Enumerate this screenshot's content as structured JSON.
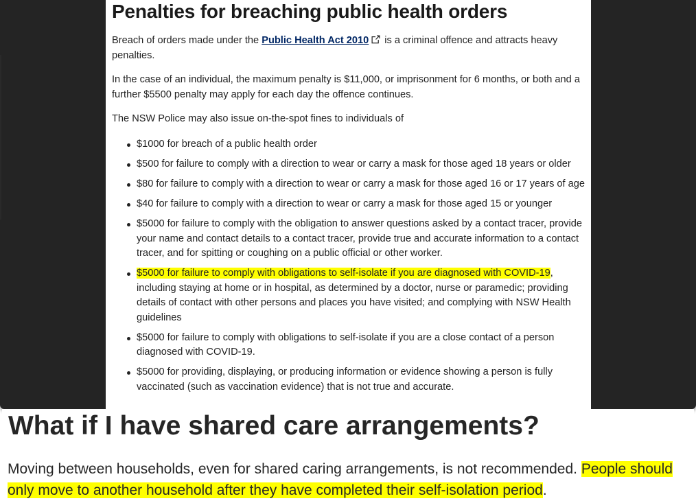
{
  "orders_section": {
    "heading": "Penalties for breaching public health orders",
    "para1_before": "Breach of orders made under the ",
    "para1_link": "Public Health Act 2010",
    "para1_link_icon": "external-link-icon",
    "para1_after": " is a criminal offence and attracts heavy penalties.",
    "para2": "In the case of an individual, the maximum penalty is $11,000, or imprisonment for 6 months, or both and a further $5500 penalty may apply for each day the offence continues.",
    "para3": "The NSW Police may also issue on-the-spot fines to individuals of",
    "fines": [
      {
        "text": "$1000 for breach of a public health order"
      },
      {
        "text": "$500 for failure to comply with a direction to wear or carry a mask for those aged 18 years or older"
      },
      {
        "text": "$80 for failure to comply with a direction to wear or carry a mask for those aged 16 or 17 years of age"
      },
      {
        "text": "$40 for failure to comply with a direction to wear or carry a mask for those aged 15 or younger"
      },
      {
        "text": "$5000 for failure to comply with the obligation to answer questions asked by a contact tracer, provide your name and contact details to a contact tracer, provide true and accurate information to a contact tracer, and for spitting or coughing on a public official or other worker."
      },
      {
        "highlight": "$5000 for failure to comply with obligations to self-isolate if you are diagnosed with COVID-19",
        "text": ", including staying at home or in hospital, as determined by a doctor, nurse or paramedic;  providing details of contact with other persons and places you have visited; and complying with NSW Health guidelines"
      },
      {
        "text": "$5000 for failure to comply with obligations to self-isolate if you are a close contact of a person diagnosed with COVID-19."
      },
      {
        "text": "$5000 for providing, displaying, or producing information or evidence showing a person is fully vaccinated (such as vaccination evidence) that is not true and accurate."
      }
    ]
  },
  "care_section": {
    "heading": "What if I have shared care arrangements?",
    "para_plain": "Moving between households, even for shared caring arrangements, is not recommended. ",
    "para_highlight": "People should only move to another household after they have completed their self-isolation period",
    "para_end": "."
  },
  "colors": {
    "highlight": "#ffff00",
    "link": "#002664",
    "backdrop": "#242424"
  }
}
